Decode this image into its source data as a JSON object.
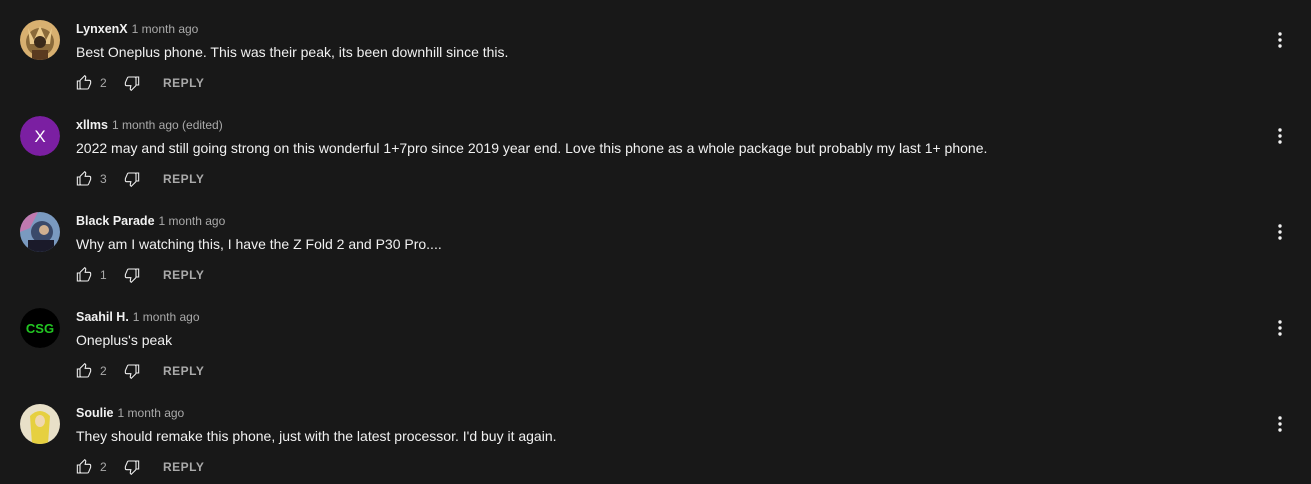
{
  "comments": [
    {
      "author": "LynxenX",
      "time": "1 month ago",
      "text": "Best Oneplus phone. This was their peak, its been downhill since this.",
      "likes": "2",
      "reply_label": "REPLY",
      "avatar": {
        "type": "image",
        "colors": [
          "#8a6a3a",
          "#d8b070",
          "#3a2a1a"
        ]
      }
    },
    {
      "author": "xllms",
      "time": "1 month ago (edited)",
      "text": "2022 may and still going strong on this wonderful 1+7pro since 2019 year end. Love this phone as a whole package but probably my last 1+ phone.",
      "likes": "3",
      "reply_label": "REPLY",
      "avatar": {
        "type": "letter",
        "letter": "X",
        "bg": "#7b1fa2"
      }
    },
    {
      "author": "Black Parade",
      "time": "1 month ago",
      "text": "Why am I watching this, I have the Z Fold 2 and P30 Pro....",
      "likes": "1",
      "reply_label": "REPLY",
      "avatar": {
        "type": "image",
        "colors": [
          "#3a4a6a",
          "#7a9ac0",
          "#1a1a2a"
        ]
      }
    },
    {
      "author": "Saahil H.",
      "time": "1 month ago",
      "text": "Oneplus's peak",
      "likes": "2",
      "reply_label": "REPLY",
      "avatar": {
        "type": "logo",
        "letter": "CSG",
        "bg": "#000000",
        "fg": "#22c522"
      }
    },
    {
      "author": "Soulie",
      "time": "1 month ago",
      "text": "They should remake this phone, just with the latest processor.  I'd buy it again.",
      "likes": "2",
      "reply_label": "REPLY",
      "avatar": {
        "type": "image",
        "colors": [
          "#e8e0c8",
          "#e6d040",
          "#b8a860"
        ]
      }
    }
  ],
  "icons": {
    "like": "thumb-up-icon",
    "dislike": "thumb-down-icon",
    "menu": "more-vert-icon"
  },
  "colors": {
    "background": "#181818",
    "text_primary": "#f1f1f1",
    "text_secondary": "#aaaaaa"
  }
}
